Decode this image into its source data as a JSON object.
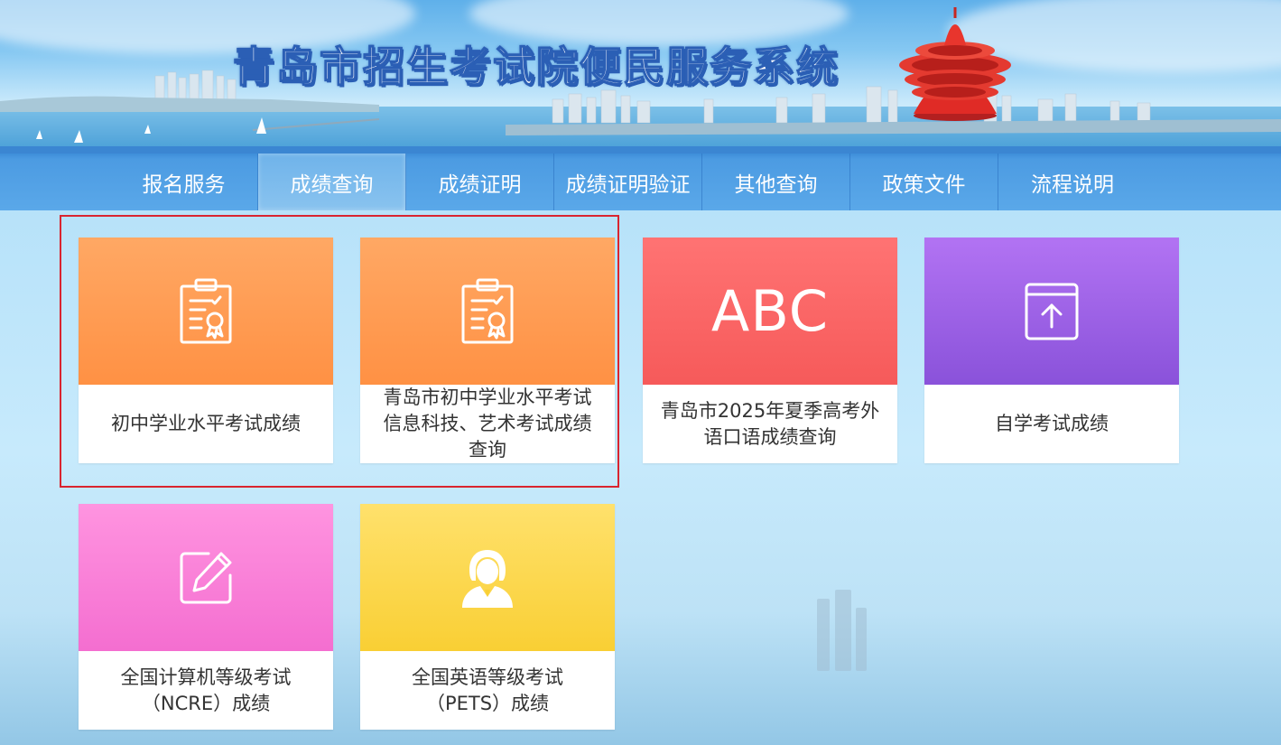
{
  "header": {
    "title": "青岛市招生考试院便民服务系统"
  },
  "nav": {
    "items": [
      {
        "label": "报名服务",
        "active": false
      },
      {
        "label": "成绩查询",
        "active": true
      },
      {
        "label": "成绩证明",
        "active": false
      },
      {
        "label": "成绩证明验证",
        "active": false
      },
      {
        "label": "其他查询",
        "active": false
      },
      {
        "label": "政策文件",
        "active": false
      },
      {
        "label": "流程说明",
        "active": false
      }
    ]
  },
  "cards": [
    {
      "label": "初中学业水平考试成绩",
      "icon": "certificate-clipboard-icon",
      "color": "#ff9a50"
    },
    {
      "label": "青岛市初中学业水平考试\n信息科技、艺术考试成绩\n查询",
      "icon": "certificate-clipboard-icon",
      "color": "#ff9a50"
    },
    {
      "label": "青岛市2025年夏季高考外\n语口语成绩查询",
      "icon": "abc-icon",
      "icon_text": "ABC",
      "color": "#f96464"
    },
    {
      "label": "自学考试成绩",
      "icon": "upload-box-icon",
      "color": "#9c60e6"
    },
    {
      "label": "全国计算机等级考试\n（NCRE）成绩",
      "icon": "edit-pencil-icon",
      "color": "#f77fd6"
    },
    {
      "label": "全国英语等级考试\n（PETS）成绩",
      "icon": "person-headset-icon",
      "color": "#fbd84a"
    }
  ]
}
